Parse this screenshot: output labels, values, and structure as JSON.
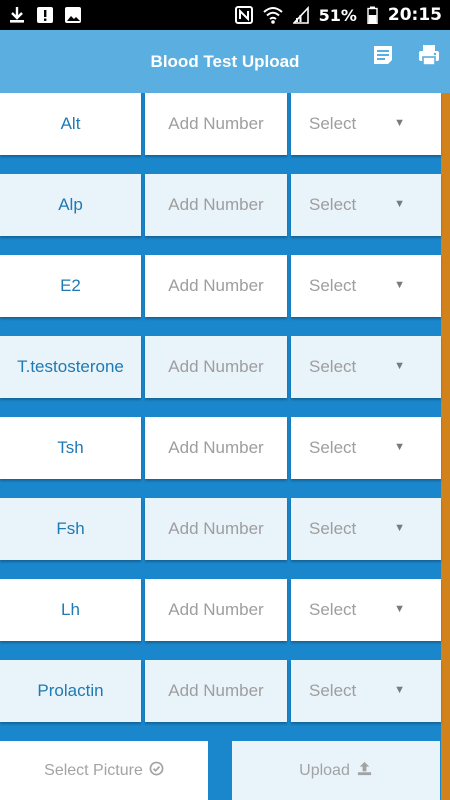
{
  "status_bar": {
    "left_icons": [
      "download-icon",
      "alert-box-icon",
      "image-icon"
    ],
    "right_icons": [
      "nfc-icon",
      "wifi-icon",
      "signal-icon"
    ],
    "battery": "51%",
    "time": "20:15"
  },
  "app_bar": {
    "title": "Blood Test Upload",
    "actions": [
      "list-icon",
      "print-icon"
    ]
  },
  "rows": [
    {
      "label": "Alt",
      "value_placeholder": "Add Number",
      "unit_select": "Select"
    },
    {
      "label": "Alp",
      "value_placeholder": "Add Number",
      "unit_select": "Select"
    },
    {
      "label": "E2",
      "value_placeholder": "Add Number",
      "unit_select": "Select"
    },
    {
      "label": "T.testosterone",
      "value_placeholder": "Add Number",
      "unit_select": "Select"
    },
    {
      "label": "Tsh",
      "value_placeholder": "Add Number",
      "unit_select": "Select"
    },
    {
      "label": "Fsh",
      "value_placeholder": "Add Number",
      "unit_select": "Select"
    },
    {
      "label": "Lh",
      "value_placeholder": "Add Number",
      "unit_select": "Select"
    },
    {
      "label": "Prolactin",
      "value_placeholder": "Add Number",
      "unit_select": "Select"
    }
  ],
  "footer": {
    "select_picture": "Select Picture",
    "upload": "Upload"
  },
  "colors": {
    "background": "#1a86cc",
    "app_bar": "#5aafe0",
    "label_text": "#1f7ab3",
    "placeholder_text": "#9e9e9e",
    "scroll_accent": "#d2821b"
  }
}
